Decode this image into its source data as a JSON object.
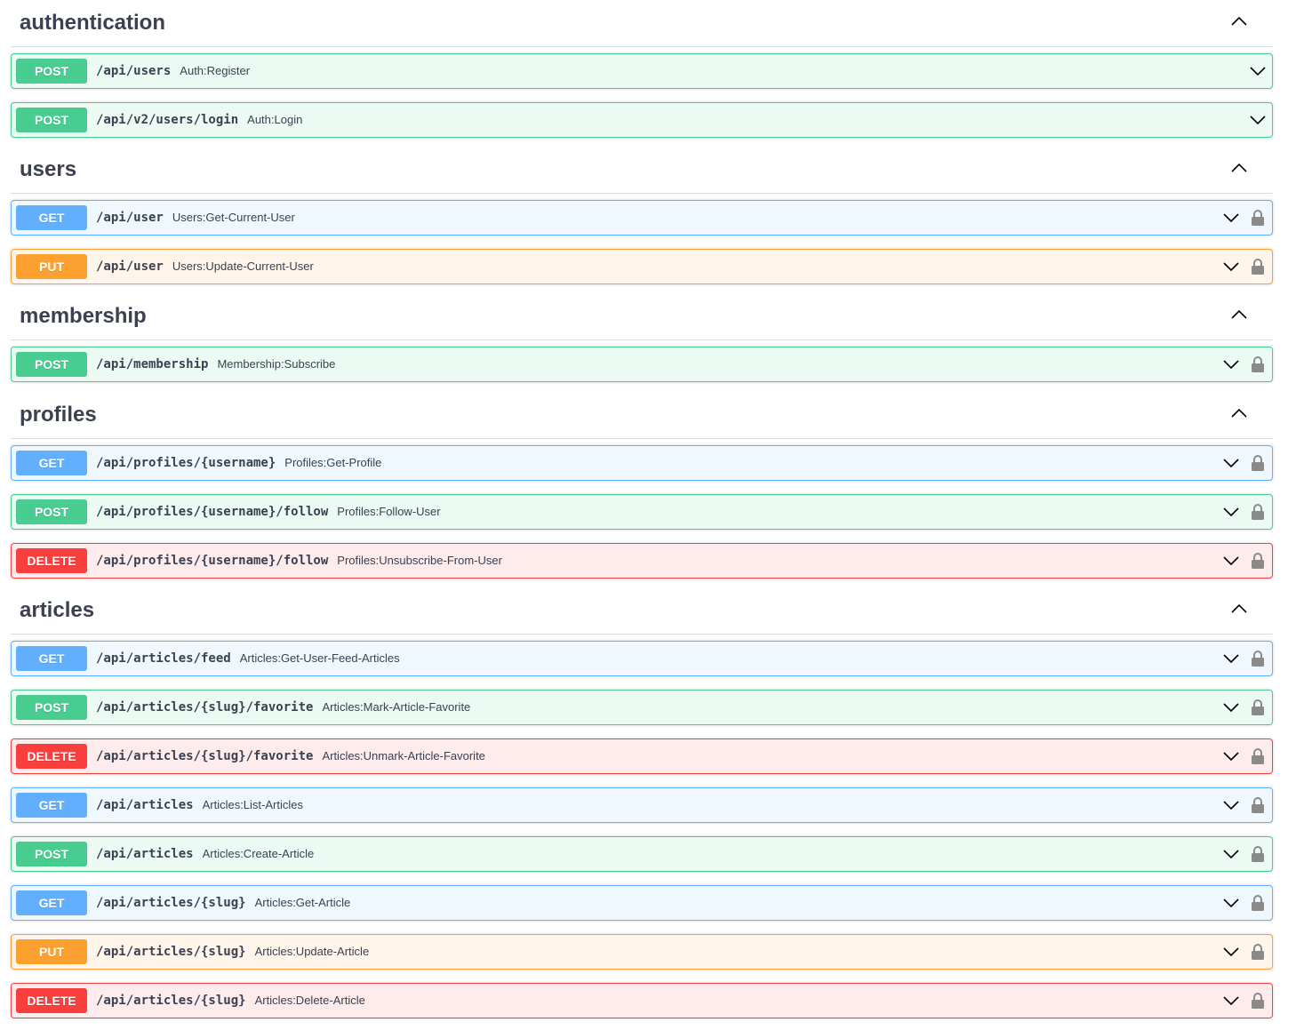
{
  "sections": [
    {
      "name": "authentication",
      "operations": [
        {
          "method": "POST",
          "path": "/api/users",
          "summary": "Auth:Register",
          "locked": false
        },
        {
          "method": "POST",
          "path": "/api/v2/users/login",
          "summary": "Auth:Login",
          "locked": false
        }
      ]
    },
    {
      "name": "users",
      "operations": [
        {
          "method": "GET",
          "path": "/api/user",
          "summary": "Users:Get-Current-User",
          "locked": true
        },
        {
          "method": "PUT",
          "path": "/api/user",
          "summary": "Users:Update-Current-User",
          "locked": true
        }
      ]
    },
    {
      "name": "membership",
      "operations": [
        {
          "method": "POST",
          "path": "/api/membership",
          "summary": "Membership:Subscribe",
          "locked": true
        }
      ]
    },
    {
      "name": "profiles",
      "operations": [
        {
          "method": "GET",
          "path": "/api/profiles/{username}",
          "summary": "Profiles:Get-Profile",
          "locked": true
        },
        {
          "method": "POST",
          "path": "/api/profiles/{username}/follow",
          "summary": "Profiles:Follow-User",
          "locked": true
        },
        {
          "method": "DELETE",
          "path": "/api/profiles/{username}/follow",
          "summary": "Profiles:Unsubscribe-From-User",
          "locked": true
        }
      ]
    },
    {
      "name": "articles",
      "operations": [
        {
          "method": "GET",
          "path": "/api/articles/feed",
          "summary": "Articles:Get-User-Feed-Articles",
          "locked": true
        },
        {
          "method": "POST",
          "path": "/api/articles/{slug}/favorite",
          "summary": "Articles:Mark-Article-Favorite",
          "locked": true
        },
        {
          "method": "DELETE",
          "path": "/api/articles/{slug}/favorite",
          "summary": "Articles:Unmark-Article-Favorite",
          "locked": true
        },
        {
          "method": "GET",
          "path": "/api/articles",
          "summary": "Articles:List-Articles",
          "locked": true
        },
        {
          "method": "POST",
          "path": "/api/articles",
          "summary": "Articles:Create-Article",
          "locked": true
        },
        {
          "method": "GET",
          "path": "/api/articles/{slug}",
          "summary": "Articles:Get-Article",
          "locked": true
        },
        {
          "method": "PUT",
          "path": "/api/articles/{slug}",
          "summary": "Articles:Update-Article",
          "locked": true
        },
        {
          "method": "DELETE",
          "path": "/api/articles/{slug}",
          "summary": "Articles:Delete-Article",
          "locked": true
        }
      ]
    }
  ],
  "method_colors": {
    "GET": "#61affe",
    "POST": "#49cc90",
    "PUT": "#fca130",
    "DELETE": "#f93e3e"
  },
  "icons": {
    "section_toggle": "chevron-up-icon",
    "operation_toggle": "chevron-down-icon",
    "auth": "lock-icon"
  }
}
